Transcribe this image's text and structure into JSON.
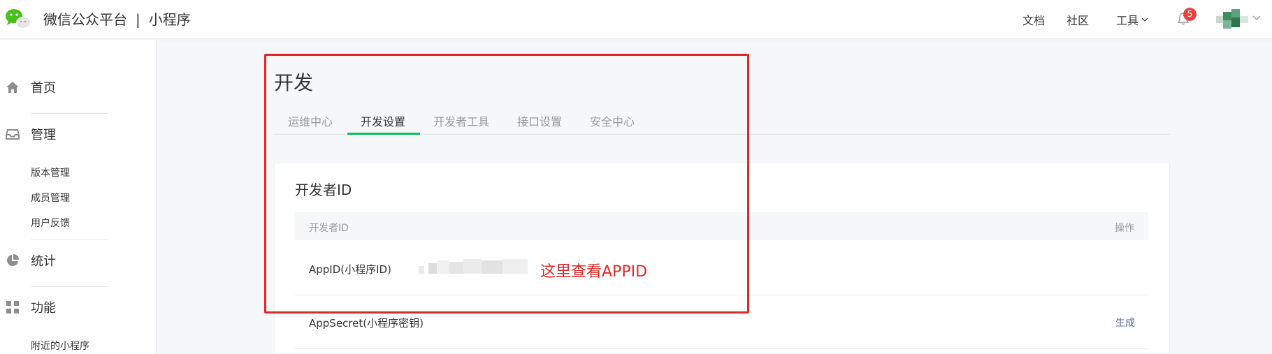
{
  "header": {
    "brand": "微信公众平台",
    "separator": "|",
    "product": "小程序",
    "nav": {
      "docs": "文档",
      "community": "社区",
      "tools": "工具"
    },
    "notification_count": "5"
  },
  "sidebar": {
    "home": "首页",
    "manage": "管理",
    "manage_items": [
      "版本管理",
      "成员管理",
      "用户反馈"
    ],
    "stats": "统计",
    "features": "功能",
    "features_items": [
      "附近的小程序"
    ]
  },
  "main": {
    "title": "开发",
    "tabs": [
      "运维中心",
      "开发设置",
      "开发者工具",
      "接口设置",
      "安全中心"
    ],
    "active_tab": "开发设置",
    "card": {
      "title": "开发者ID",
      "columns": [
        "开发者ID",
        "操作"
      ],
      "rows": [
        {
          "label": "AppID(小程序ID)",
          "action": ""
        },
        {
          "label": "AppSecret(小程序密钥)",
          "action": "生成"
        }
      ]
    },
    "annotation": "这里查看APPID"
  },
  "colors": {
    "accent_green": "#07c160",
    "annotation_red": "#e02828",
    "link_blue": "#576b95",
    "badge_red": "#e64340"
  }
}
